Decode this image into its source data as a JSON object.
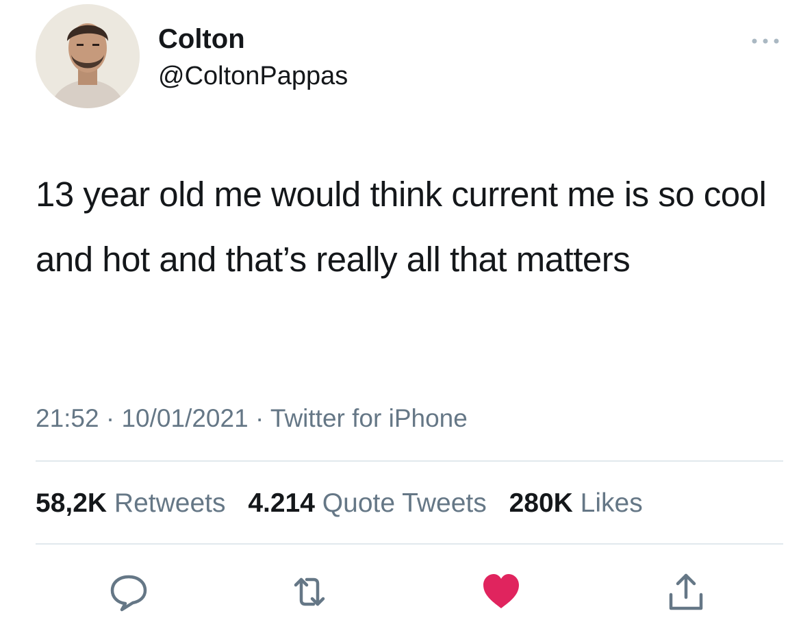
{
  "user": {
    "display_name": "Colton",
    "handle": "@ColtonPappas",
    "avatar_icon": "profile-photo"
  },
  "tweet": {
    "text": "13 year old me would think current me is so cool and hot and that’s really all that matters"
  },
  "meta": {
    "time": "21:52",
    "separator": "·",
    "date": "10/01/2021",
    "source": "Twitter for iPhone"
  },
  "stats": {
    "retweets_count": "58,2K",
    "retweets_label": "Retweets",
    "quotes_count": "4.214",
    "quotes_label": "Quote Tweets",
    "likes_count": "280K",
    "likes_label": "Likes"
  },
  "actions": {
    "reply_icon": "speech-bubble",
    "retweet_icon": "retweet-arrows",
    "like_icon": "heart",
    "share_icon": "share-arrow-up",
    "like_color": "#e0245e",
    "icon_color": "#657786"
  },
  "colors": {
    "text": "#14171a",
    "muted": "#657786",
    "divider": "#e1e8ed"
  }
}
